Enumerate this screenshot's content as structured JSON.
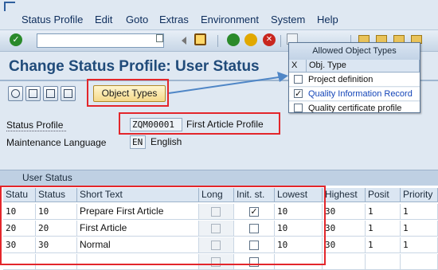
{
  "menu": {
    "items": [
      "Status Profile",
      "Edit",
      "Goto",
      "Extras",
      "Environment",
      "System",
      "Help"
    ]
  },
  "toolbar": {
    "command_field_value": "",
    "icons": [
      "enter-check",
      "save",
      "back",
      "exit",
      "cancel",
      "print",
      "find",
      "find-next",
      "first-page",
      "previous-page",
      "next-page",
      "last-page"
    ]
  },
  "page": {
    "title": "Change Status Profile: User Status"
  },
  "app_toolbar": {
    "object_types_label": "Object Types"
  },
  "header": {
    "status_profile_label": "Status Profile",
    "status_profile_code": "ZQM00001",
    "status_profile_text": "First Article Profile",
    "maintenance_language_label": "Maintenance Language",
    "maintenance_language_code": "EN",
    "maintenance_language_text": "English"
  },
  "user_status": {
    "section_title": "User Status",
    "columns": [
      "Statu",
      "Status",
      "Short Text",
      "Long",
      "Init. st.",
      "Lowest",
      "Highest",
      "Posit",
      "Priority"
    ],
    "rows": [
      {
        "statu": "10",
        "status": "10",
        "short_text": "Prepare First Article",
        "long": false,
        "init": true,
        "lowest": "10",
        "highest": "30",
        "posit": "1",
        "priority": "1"
      },
      {
        "statu": "20",
        "status": "20",
        "short_text": "First Article",
        "long": false,
        "init": false,
        "lowest": "10",
        "highest": "30",
        "posit": "1",
        "priority": "1"
      },
      {
        "statu": "30",
        "status": "30",
        "short_text": "Normal",
        "long": false,
        "init": false,
        "lowest": "10",
        "highest": "30",
        "posit": "1",
        "priority": "1"
      }
    ]
  },
  "popup": {
    "title": "Allowed Object Types",
    "col_x": "X",
    "col_obj_type": "Obj. Type",
    "items": [
      {
        "label": "Project definition",
        "checked": false
      },
      {
        "label": "Quality Information Record",
        "checked": true
      },
      {
        "label": "Quality certificate profile",
        "checked": false
      }
    ]
  },
  "colors": {
    "highlight": "#e3262b",
    "title": "#204b7a",
    "arrow": "#4f86c6",
    "link": "#1445b8"
  }
}
